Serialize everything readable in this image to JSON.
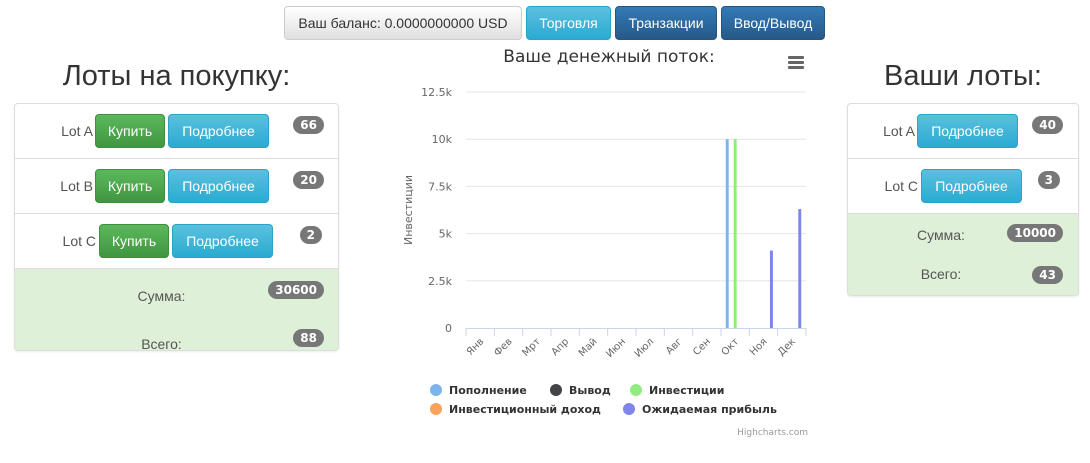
{
  "topbar": {
    "balance_label": "Ваш баланс: 0.0000000000 USD",
    "trade_label": "Торговля",
    "transactions_label": "Транзакции",
    "deposit_label": "Ввод/Вывод"
  },
  "buy_lots": {
    "title": "Лоты на покупку:",
    "items": [
      {
        "name": "Lot A",
        "buy_label": "Купить",
        "details_label": "Подробнее",
        "count": "66"
      },
      {
        "name": "Lot B",
        "buy_label": "Купить",
        "details_label": "Подробнее",
        "count": "20"
      },
      {
        "name": "Lot C",
        "buy_label": "Купить",
        "details_label": "Подробнее",
        "count": "2"
      }
    ],
    "sum_label": "Сумма:",
    "sum_value": "30600",
    "total_label": "Всего:",
    "total_value": "88"
  },
  "my_lots": {
    "title": "Ваши лоты:",
    "items": [
      {
        "name": "Lot A",
        "details_label": "Подробнее",
        "count": "40"
      },
      {
        "name": "Lot C",
        "details_label": "Подробнее",
        "count": "3"
      }
    ],
    "sum_label": "Сумма:",
    "sum_value": "10000",
    "total_label": "Всего:",
    "total_value": "43"
  },
  "chart_data": {
    "type": "bar",
    "title": "Ваше денежный поток:",
    "ylabel": "Инвестиции",
    "xlabel": "",
    "ylim": [
      0,
      12500
    ],
    "yticks": [
      0,
      2500,
      5000,
      7500,
      10000,
      12500
    ],
    "ytick_labels": [
      "0",
      "2.5k",
      "5k",
      "7.5k",
      "10k",
      "12.5k"
    ],
    "categories": [
      "Янв",
      "Фев",
      "Мрт",
      "Апр",
      "Май",
      "Июн",
      "Июл",
      "Авг",
      "Сен",
      "Окт",
      "Ноя",
      "Дек"
    ],
    "series": [
      {
        "name": "Пополнение",
        "color": "#7cb5ec",
        "values": [
          0,
          0,
          0,
          0,
          0,
          0,
          0,
          0,
          0,
          10000,
          0,
          0
        ]
      },
      {
        "name": "Вывод",
        "color": "#434348",
        "values": [
          0,
          0,
          0,
          0,
          0,
          0,
          0,
          0,
          0,
          0,
          0,
          0
        ]
      },
      {
        "name": "Инвестиции",
        "color": "#90ed7d",
        "values": [
          0,
          0,
          0,
          0,
          0,
          0,
          0,
          0,
          0,
          10000,
          0,
          0
        ]
      },
      {
        "name": "Инвестиционный доход",
        "color": "#f7a35c",
        "values": [
          0,
          0,
          0,
          0,
          0,
          0,
          0,
          0,
          0,
          0,
          0,
          0
        ]
      },
      {
        "name": "Ожидаемая прибыль",
        "color": "#8085e9",
        "values": [
          0,
          0,
          0,
          0,
          0,
          0,
          0,
          0,
          0,
          0,
          4100,
          6300
        ]
      }
    ],
    "legend_position": "bottom",
    "grid": true,
    "credits": "Highcharts.com"
  },
  "colors": {
    "success": "#5cb85c",
    "info": "#5bc0de",
    "primary": "#337ab7",
    "sum_bg": "#dff0d8",
    "badge": "#777777"
  },
  "icons": {
    "chart_menu": "hamburger-menu-icon"
  }
}
